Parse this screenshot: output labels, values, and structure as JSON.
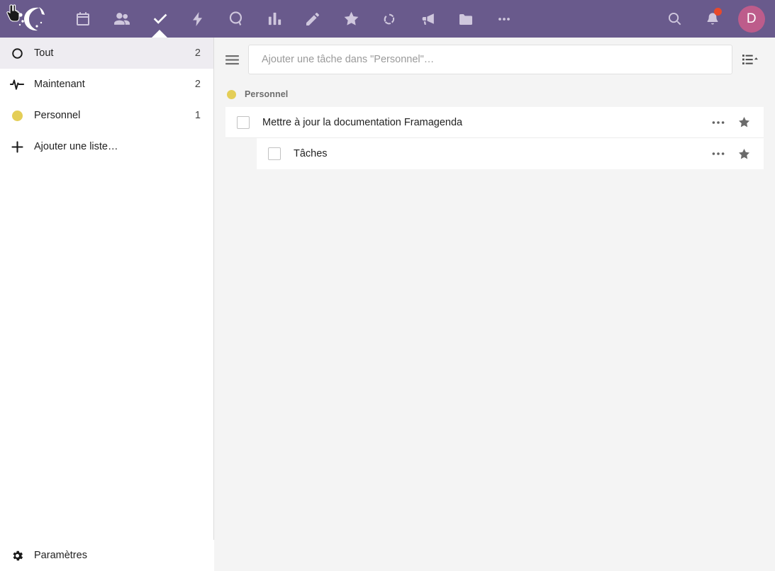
{
  "topbar": {
    "background_color": "#695a8c",
    "logo": {
      "name": "framasoft-logo",
      "alt": "Framasoft"
    },
    "cursor": {
      "name": "hand-cursor"
    },
    "nav_items": [
      {
        "icon": "calendar-icon",
        "label": "Agenda",
        "active": false
      },
      {
        "icon": "contacts-icon",
        "label": "Contacts",
        "active": false
      },
      {
        "icon": "check-icon",
        "label": "Tâches",
        "active": true
      },
      {
        "icon": "activity-bolt-icon",
        "label": "Activité",
        "active": false
      },
      {
        "icon": "search-circle-icon",
        "label": "Recherche",
        "active": false
      },
      {
        "icon": "chart-bars-icon",
        "label": "Statistiques",
        "active": false
      },
      {
        "icon": "pencil-icon",
        "label": "Notes",
        "active": false
      },
      {
        "icon": "star-icon",
        "label": "Favoris",
        "active": false
      },
      {
        "icon": "sync-icon",
        "label": "Synchronisation",
        "active": false
      },
      {
        "icon": "megaphone-icon",
        "label": "Annonces",
        "active": false
      },
      {
        "icon": "folder-icon",
        "label": "Fichiers",
        "active": false
      },
      {
        "icon": "ellipsis-icon",
        "label": "Plus",
        "active": false
      }
    ],
    "right_actions": [
      {
        "icon": "search-icon",
        "label": "Rechercher"
      },
      {
        "icon": "bell-icon",
        "label": "Notifications",
        "badge": true,
        "badge_color": "#e8492b"
      }
    ],
    "avatar": {
      "initial": "D",
      "color": "#bd5c8b"
    }
  },
  "sidebar": {
    "items": [
      {
        "icon": "circle-outline-icon",
        "label": "Tout",
        "count": "2",
        "selected": true,
        "color": ""
      },
      {
        "icon": "pulse-icon",
        "label": "Maintenant",
        "count": "2",
        "selected": false,
        "color": ""
      },
      {
        "icon": "dot-icon",
        "label": "Personnel",
        "count": "1",
        "selected": false,
        "color": "#e4ce57"
      },
      {
        "icon": "plus-icon",
        "label": "Ajouter une liste…",
        "count": "",
        "selected": false,
        "color": ""
      }
    ],
    "settings": {
      "icon": "gear-icon",
      "label": "Paramètres"
    }
  },
  "main": {
    "menu_icon": "hamburger-icon",
    "add_task": {
      "placeholder": "Ajouter une tâche dans \"Personnel\"…",
      "value": ""
    },
    "sort_icon": "sort-list-ascending-icon",
    "groups": [
      {
        "title": "Personnel",
        "color": "#e4ce57",
        "tasks": [
          {
            "title": "Mettre à jour la documentation Framagenda",
            "level": 0,
            "checked": false,
            "starred": true
          },
          {
            "title": "Tâches",
            "level": 1,
            "checked": false,
            "starred": true
          }
        ]
      }
    ]
  }
}
